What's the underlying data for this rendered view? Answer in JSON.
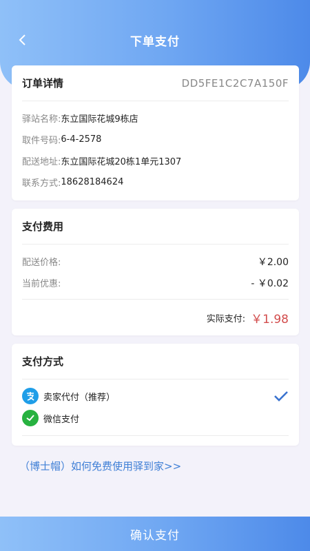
{
  "header": {
    "title": "下单支付",
    "back_icon": "chevron-left-icon"
  },
  "order": {
    "title": "订单详情",
    "id": "DD5FE1C2C7A150F",
    "fields": [
      {
        "label": "驿站名称:",
        "value": "东立国际花城9栋店"
      },
      {
        "label": "取件号码:",
        "value": "6-4-2578"
      },
      {
        "label": "配送地址:",
        "value": "东立国际花城20栋1单元1307"
      },
      {
        "label": "联系方式:",
        "value": "18628184624"
      }
    ]
  },
  "fee": {
    "title": "支付费用",
    "delivery_label": "配送价格:",
    "delivery_value": "￥2.00",
    "discount_label": "当前优惠:",
    "discount_value": "- ￥0.02",
    "total_label": "实际支付:",
    "total_value": "￥1.98",
    "total_color": "#d24c4c"
  },
  "payment": {
    "title": "支付方式",
    "methods": [
      {
        "label": "卖家代付（推荐）",
        "icon": "alipay-icon",
        "color": "#1f9ee8",
        "selected": true
      },
      {
        "label": "微信支付",
        "icon": "wechat-icon",
        "color": "#27b240",
        "selected": false
      }
    ],
    "check_color": "#3a73cf"
  },
  "link_text": "（博士帽）如何免费使用驿到家>>",
  "confirm_label": "确认支付"
}
